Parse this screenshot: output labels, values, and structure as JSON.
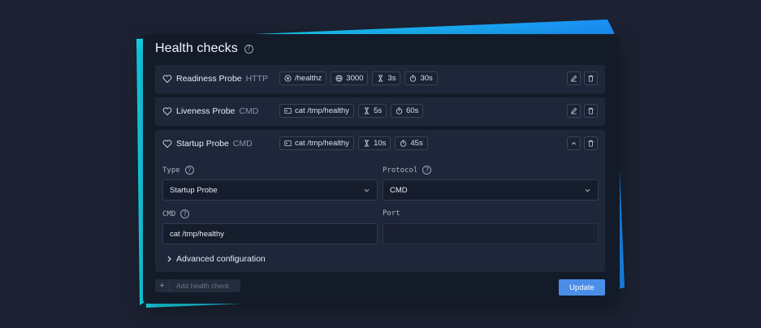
{
  "title": "Health checks",
  "probes": [
    {
      "name": "Readiness Probe",
      "type": "HTTP",
      "chips": [
        {
          "icon": "target-icon",
          "text": "/healthz"
        },
        {
          "icon": "globe-icon",
          "text": "3000"
        },
        {
          "icon": "hourglass-icon",
          "text": "3s"
        },
        {
          "icon": "stopwatch-icon",
          "text": "30s"
        }
      ]
    },
    {
      "name": "Liveness Probe",
      "type": "CMD",
      "chips": [
        {
          "icon": "terminal-icon",
          "text": "cat /tmp/healthy"
        },
        {
          "icon": "hourglass-icon",
          "text": "5s"
        },
        {
          "icon": "stopwatch-icon",
          "text": "60s"
        }
      ]
    },
    {
      "name": "Startup Probe",
      "type": "CMD",
      "chips": [
        {
          "icon": "terminal-icon",
          "text": "cat /tmp/healthy"
        },
        {
          "icon": "hourglass-icon",
          "text": "10s"
        },
        {
          "icon": "stopwatch-icon",
          "text": "45s"
        }
      ]
    }
  ],
  "form": {
    "type_label": "Type",
    "type_value": "Startup Probe",
    "protocol_label": "Protocol",
    "protocol_value": "CMD",
    "cmd_label": "CMD",
    "cmd_value": "cat /tmp/healthy",
    "port_label": "Port",
    "port_value": "",
    "advanced_label": "Advanced configuration"
  },
  "footer": {
    "add_label": "Add health check",
    "add_plus": "+",
    "update_label": "Update"
  },
  "help_glyph": "?",
  "colors": {
    "background": "#1c2232",
    "panel": "#141b28",
    "row": "#1e2639",
    "accent_cyan": "#19d3f0",
    "accent_blue": "#1f8ff5",
    "update_button": "#4b8ee7"
  }
}
